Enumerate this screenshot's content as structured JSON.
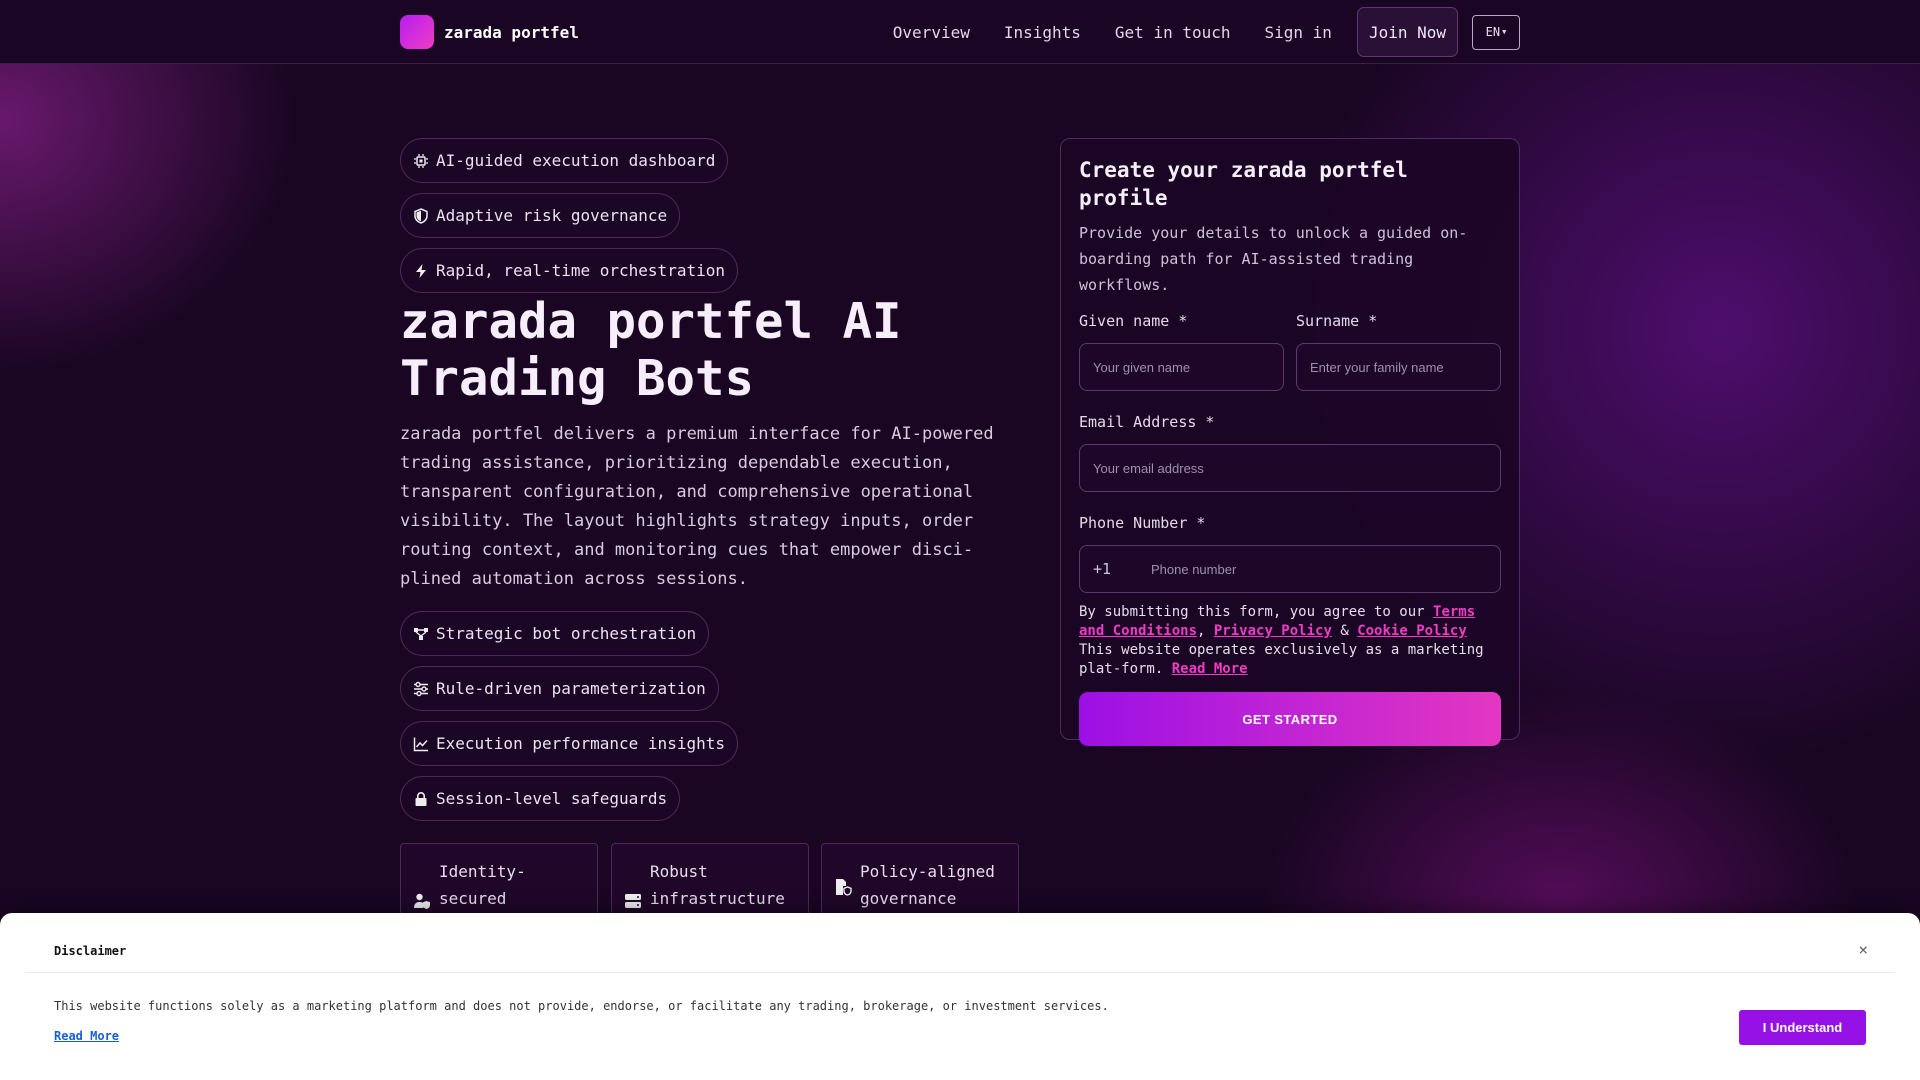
{
  "header": {
    "brand": "zarada portfel",
    "nav": [
      "Overview",
      "Insights",
      "Get in touch",
      "Sign in"
    ],
    "join_label": "Join Now",
    "lang": "EN"
  },
  "hero": {
    "badges": [
      {
        "icon": "chip-icon",
        "label": "AI-guided execution dashboard"
      },
      {
        "icon": "shield-icon",
        "label": "Adaptive risk governance"
      },
      {
        "icon": "bolt-icon",
        "label": "Rapid, real-time orchestration"
      }
    ],
    "title": "zarada portfel AI Trading Bots",
    "description": "zarada portfel delivers a premium interface for AI-powered trading assistance, prioritizing dependable execution, transparent configuration, and comprehensive operational visibility. The layout highlights strategy inputs, order routing context, and monitoring cues that empower disci-plined automation across sessions.",
    "features": [
      {
        "icon": "nodes-icon",
        "label": "Strategic bot orchestration"
      },
      {
        "icon": "sliders-icon",
        "label": "Rule-driven parameterization"
      },
      {
        "icon": "chart-line-icon",
        "label": "Execution performance insights"
      },
      {
        "icon": "lock-icon",
        "label": "Session-level safeguards"
      }
    ],
    "cards": [
      {
        "icon": "user-shield-icon",
        "label": "Identity-secured"
      },
      {
        "icon": "server-icon",
        "label": "Robust infrastructure"
      },
      {
        "icon": "document-shield-icon",
        "label": "Policy-aligned governance"
      }
    ]
  },
  "form": {
    "title": "Create your zarada portfel profile",
    "subtitle": "Provide your details to unlock a guided on-boarding path for AI-assisted trading workflows.",
    "given_label": "Given name *",
    "given_placeholder": "Your given name",
    "surname_label": "Surname *",
    "surname_placeholder": "Enter your family name",
    "email_label": "Email Address *",
    "email_placeholder": "Your email address",
    "phone_label": "Phone Number *",
    "phone_code": "+1",
    "phone_placeholder": "Phone number",
    "consent_prefix": "By submitting this form, you agree to our ",
    "terms_link": "Terms and Conditions",
    "sep1": ", ",
    "privacy_link": "Privacy Policy",
    "sep2": " & ",
    "cookie_link": "Cookie Policy",
    "consent_suffix": " This website operates exclusively as a marketing plat-form. ",
    "read_more": "Read More",
    "submit_label": "GET STARTED"
  },
  "disclaimer": {
    "title": "Disclaimer",
    "close": "×",
    "text": "This website functions solely as a marketing platform and does not provide, endorse, or facilitate any trading, brokerage, or investment services.",
    "read_more": "Read More",
    "button": "I Understand"
  },
  "colors": {
    "background": "#1a0623",
    "accent": "#9c10e6",
    "accent_pink": "#e437c2",
    "link": "#f03cc4"
  }
}
